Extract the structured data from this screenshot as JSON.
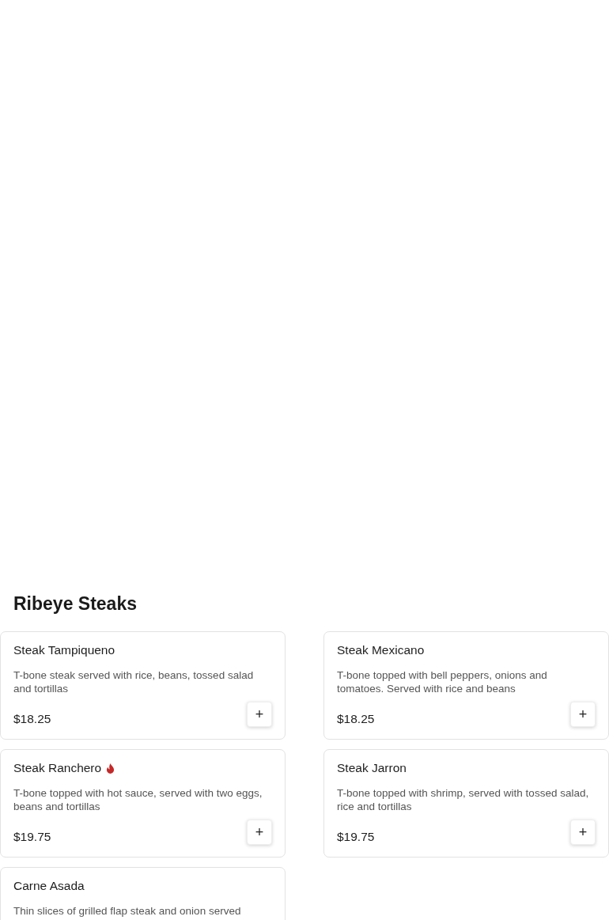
{
  "section": {
    "title": "Ribeye Steaks",
    "items": [
      {
        "name": "Steak Tampiqueno",
        "spicy": false,
        "description": "T-bone steak served with rice, beans, tossed salad and tortillas",
        "price": "$18.25",
        "add": "+"
      },
      {
        "name": "Steak Mexicano",
        "spicy": false,
        "description": "T-bone topped with bell peppers, onions and tomatoes. Served with rice and beans",
        "price": "$18.25",
        "add": "+"
      },
      {
        "name": "Steak Ranchero",
        "spicy": true,
        "description": "T-bone topped with hot sauce, served with two eggs, beans and tortillas",
        "price": "$19.75",
        "add": "+"
      },
      {
        "name": "Steak Jarron",
        "spicy": false,
        "description": "T-bone topped with shrimp, served with tossed salad, rice and tortillas",
        "price": "$19.75",
        "add": "+"
      },
      {
        "name": "Carne Asada",
        "spicy": false,
        "description": "Thin slices of grilled flap steak and onion served"
      }
    ]
  }
}
